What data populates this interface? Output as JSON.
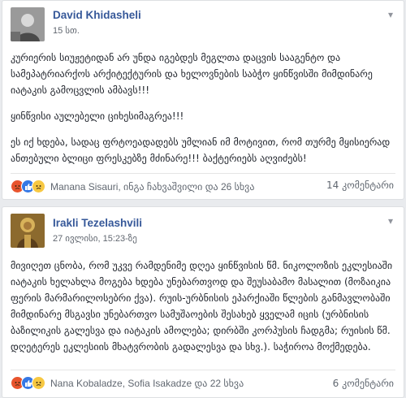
{
  "posts": [
    {
      "author": "David Khidasheli",
      "time": "15 სთ.",
      "paragraphs": [
        "კურიერის სიუჟეტიდან არ უნდა იგებდეს მეგლთა დაცვის სააგენტო და სამეპატრიარქოს არქიტექტურის და ხელოვნების საბჭო ყინწვისში მიმდინარე იატაკის გამოცვლის ამბავს!!!",
        "ყინწვისი აულებელი ციხესიმაგრეა!!!",
        "ეს იქ ხდება, სადაც ფრტოეადადებს უმლიან იმ მოტივით, რომ თურმე მყისიერად ანთებული ბლიცი ფრესკებზე მძინარე!!! ბაქტერიებს აღვიძებს!"
      ],
      "reactions_text": "Manana Sisauri, ინგა ჩახვაშვილი და 26 სხვა",
      "comments_text": "14 კომენტარი"
    },
    {
      "author": "Irakli Tezelashvili",
      "time": "27 ივლისი, 15:23-ზე",
      "paragraphs": [
        "მივიღეთ ცნობა, რომ უკვე რამდენიმე დღეა ყინწვისის წმ. ნიკოლოზის ეკლესიაში იატაკის ხელახლა მოგება ხდება უნებართვოდ და შეუსაბამო მასალით (მოზაიკია ფერის მარმარილოსებრი ქვა). რუის-ურბნისის ეპარქიაში წლების განმავლობაში მიმდინარე მსგავსი უნებართვო სამუშაოების შესახებ ყველამ იცის (ურბნისის ბაზილიკის გალესვა და იატაკის ამოლება; დირბში კორპუსის ჩადგმა; რუისის წმ. დღეტერეს ეკლესიის მხატვრობის გადალესვა და სხვ.). საჭიროა მოქმედება."
      ],
      "reactions_text": "Nana Kobaladze, Sofia Isakadze და 22 სხვა",
      "comments_text": "6 კომენტარი"
    }
  ],
  "icons": {
    "chevron": "chevron-down-icon",
    "angry": "angry-reaction-icon",
    "like": "like-reaction-icon",
    "sad": "sad-reaction-icon"
  },
  "colors": {
    "author_link": "#365899",
    "angry": "#e8542d",
    "like": "#3578e5",
    "sad": "#f7c842"
  }
}
